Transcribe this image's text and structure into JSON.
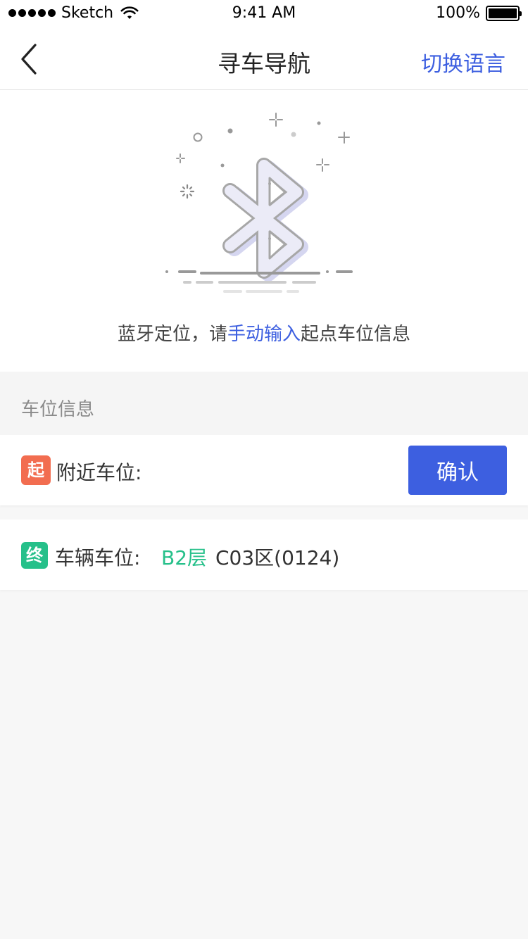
{
  "status_bar": {
    "carrier": "Sketch",
    "time": "9:41 AM",
    "battery": "100%"
  },
  "nav": {
    "title": "寻车导航",
    "switch_language": "切换语言"
  },
  "hero": {
    "message_prefix": "蓝牙定位，请",
    "message_link": "手动输入",
    "message_suffix": "起点车位信息"
  },
  "section": {
    "title": "车位信息"
  },
  "start_row": {
    "badge": "起",
    "label": "附近车位:",
    "confirm": "确认"
  },
  "end_row": {
    "badge": "终",
    "label": "车辆车位:",
    "floor": "B2层",
    "zone": "C03区(0124)"
  },
  "colors": {
    "accent": "#3d5fe0",
    "start_badge": "#f26d50",
    "end_badge": "#26c08a"
  }
}
